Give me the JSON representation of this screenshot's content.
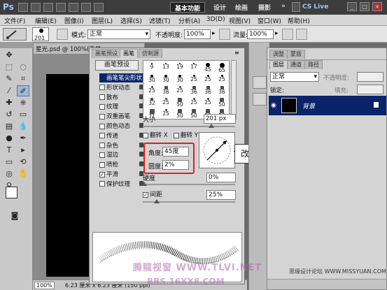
{
  "titlebar": {
    "app_logo": "Ps",
    "workspaces": [
      "基本功能",
      "设计",
      "绘画",
      "摄影"
    ],
    "more": "»",
    "cslive": "CS Live"
  },
  "menubar": {
    "items": [
      "文件(F)",
      "编辑(E)",
      "图像(I)",
      "图层(L)",
      "选择(S)",
      "滤镜(T)",
      "分析(A)",
      "3D(D)",
      "视图(V)",
      "窗口(W)",
      "帮助(H)"
    ]
  },
  "options": {
    "brush_size": "201",
    "mode_label": "模式:",
    "mode_value": "正常",
    "opacity_label": "不透明度:",
    "opacity_value": "100%",
    "flow_label": "流量:",
    "flow_value": "100%"
  },
  "document": {
    "tab_title": "星光.psd @ 100%(背景",
    "zoom": "100%",
    "docinfo": "6.23 厘米 x 6.23 厘米 (150 ppi)"
  },
  "brush_panel": {
    "tabs": [
      "画笔预设",
      "画笔",
      "仿制源"
    ],
    "preset_button": "画笔预设",
    "options": [
      {
        "label": "画笔笔尖形状",
        "checked": false,
        "selected": true
      },
      {
        "label": "形状动态",
        "checked": false
      },
      {
        "label": "散布",
        "checked": false
      },
      {
        "label": "纹理",
        "checked": false
      },
      {
        "label": "双重画笔",
        "checked": false
      },
      {
        "label": "颜色动态",
        "checked": false
      },
      {
        "label": "传递",
        "checked": false
      },
      {
        "label": "杂色",
        "checked": false
      },
      {
        "label": "湿边",
        "checked": false
      },
      {
        "label": "喷枪",
        "checked": false
      },
      {
        "label": "平滑",
        "checked": true
      },
      {
        "label": "保护纹理",
        "checked": false
      }
    ],
    "tip_sizes": [
      [
        "9",
        "13",
        "19",
        "17",
        "45",
        "65"
      ],
      [
        "30",
        "30",
        "30",
        "25",
        "25",
        "25"
      ],
      [
        "25",
        "36",
        "25",
        "36",
        "36",
        "36"
      ],
      [
        "32",
        "25",
        "50",
        "25",
        "25",
        "50"
      ],
      [
        "71",
        "25",
        "50",
        "50",
        "50",
        "50"
      ]
    ],
    "size_label": "大小",
    "size_value": "201 px",
    "flip_x": "翻转 X",
    "flip_y": "翻转 Y",
    "angle_label": "角度:",
    "angle_value": "45度",
    "roundness_label": "圆度:",
    "roundness_value": "2%",
    "hardness_label": "硬度",
    "hardness_value": "0%",
    "spacing_label": "间距",
    "spacing_checked": true,
    "spacing_value": "25%"
  },
  "annotation": {
    "callout": "改变角度"
  },
  "layers_panel": {
    "tabs": [
      "调整",
      "蒙版"
    ],
    "subtabs": [
      "图层",
      "通道",
      "路径"
    ],
    "blend_mode": "正常",
    "opacity_label": "不透明度:",
    "lock_label": "锁定:",
    "fill_label": "填充:",
    "layer_name": "背景"
  },
  "watermark": {
    "line1": "思缘设计论坛  WWW.MISSYUAN.COM",
    "line2": "腾龍视窗 WWW.TLVI.NET",
    "line3": "BBS.16XX8.COM"
  }
}
